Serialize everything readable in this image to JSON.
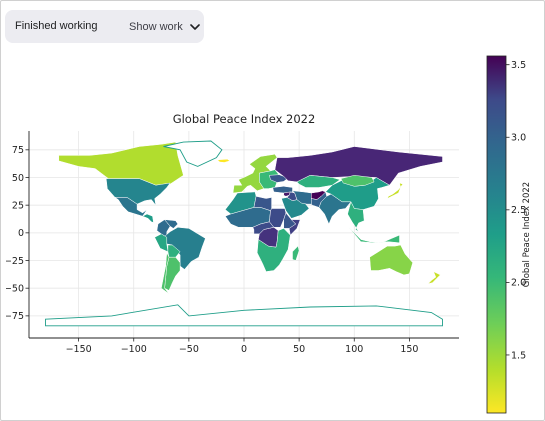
{
  "toolbar": {
    "status": "Finished working",
    "show_work_label": "Show work",
    "chevron_icon": "chevron-down-icon"
  },
  "chart_data": {
    "type": "choropleth",
    "title": "Global Peace Index 2022",
    "xlabel": "",
    "ylabel": "",
    "xlim": [
      -195,
      195
    ],
    "ylim": [
      -95,
      92
    ],
    "xticks": [
      -150,
      -100,
      -50,
      0,
      50,
      100,
      150
    ],
    "yticks": [
      -75,
      -50,
      -25,
      0,
      25,
      50,
      75
    ],
    "grid": true,
    "colormap": "viridis_r",
    "colorbar": {
      "label": "Global Peace Index 2022",
      "range": [
        1.1,
        3.56
      ],
      "ticks": [
        1.5,
        2.0,
        2.5,
        3.0,
        3.5
      ],
      "position": "right"
    },
    "regions": [
      {
        "name": "Canada",
        "value": 1.39
      },
      {
        "name": "United States",
        "value": 2.44
      },
      {
        "name": "Mexico",
        "value": 2.6
      },
      {
        "name": "Central America",
        "value": 2.2
      },
      {
        "name": "Colombia",
        "value": 2.7
      },
      {
        "name": "Venezuela",
        "value": 2.7
      },
      {
        "name": "Brazil",
        "value": 2.5
      },
      {
        "name": "Peru",
        "value": 2.1
      },
      {
        "name": "Bolivia",
        "value": 2.0
      },
      {
        "name": "Argentina",
        "value": 1.8
      },
      {
        "name": "Chile",
        "value": 1.8
      },
      {
        "name": "Greenland",
        "value": null
      },
      {
        "name": "Iceland",
        "value": 1.1
      },
      {
        "name": "Western Europe",
        "value": 1.5
      },
      {
        "name": "Eastern Europe",
        "value": 1.9
      },
      {
        "name": "Ukraine",
        "value": 2.9
      },
      {
        "name": "Russia",
        "value": 3.3
      },
      {
        "name": "Kazakhstan",
        "value": 2.0
      },
      {
        "name": "Turkey",
        "value": 2.8
      },
      {
        "name": "Middle East",
        "value": 2.4
      },
      {
        "name": "Syria",
        "value": 3.4
      },
      {
        "name": "Iraq",
        "value": 3.0
      },
      {
        "name": "Iran",
        "value": 2.7
      },
      {
        "name": "Afghanistan",
        "value": 3.55
      },
      {
        "name": "Pakistan",
        "value": 2.8
      },
      {
        "name": "India",
        "value": 2.6
      },
      {
        "name": "China",
        "value": 2.2
      },
      {
        "name": "Mongolia",
        "value": 1.8
      },
      {
        "name": "Southeast Asia",
        "value": 2.0
      },
      {
        "name": "Japan",
        "value": 1.3
      },
      {
        "name": "North Africa",
        "value": 2.3
      },
      {
        "name": "Libya",
        "value": 2.9
      },
      {
        "name": "Sahel",
        "value": 2.7
      },
      {
        "name": "Sudan",
        "value": 3.0
      },
      {
        "name": "Ethiopia",
        "value": 2.9
      },
      {
        "name": "Somalia",
        "value": 3.1
      },
      {
        "name": "DR Congo",
        "value": 3.2
      },
      {
        "name": "Central Africa",
        "value": 3.0
      },
      {
        "name": "Southern Africa",
        "value": 2.0
      },
      {
        "name": "Madagascar",
        "value": 1.9
      },
      {
        "name": "Australia",
        "value": 1.55
      },
      {
        "name": "New Zealand",
        "value": 1.3
      },
      {
        "name": "Indonesia",
        "value": 1.9
      },
      {
        "name": "Antarctica",
        "value": null
      }
    ]
  }
}
